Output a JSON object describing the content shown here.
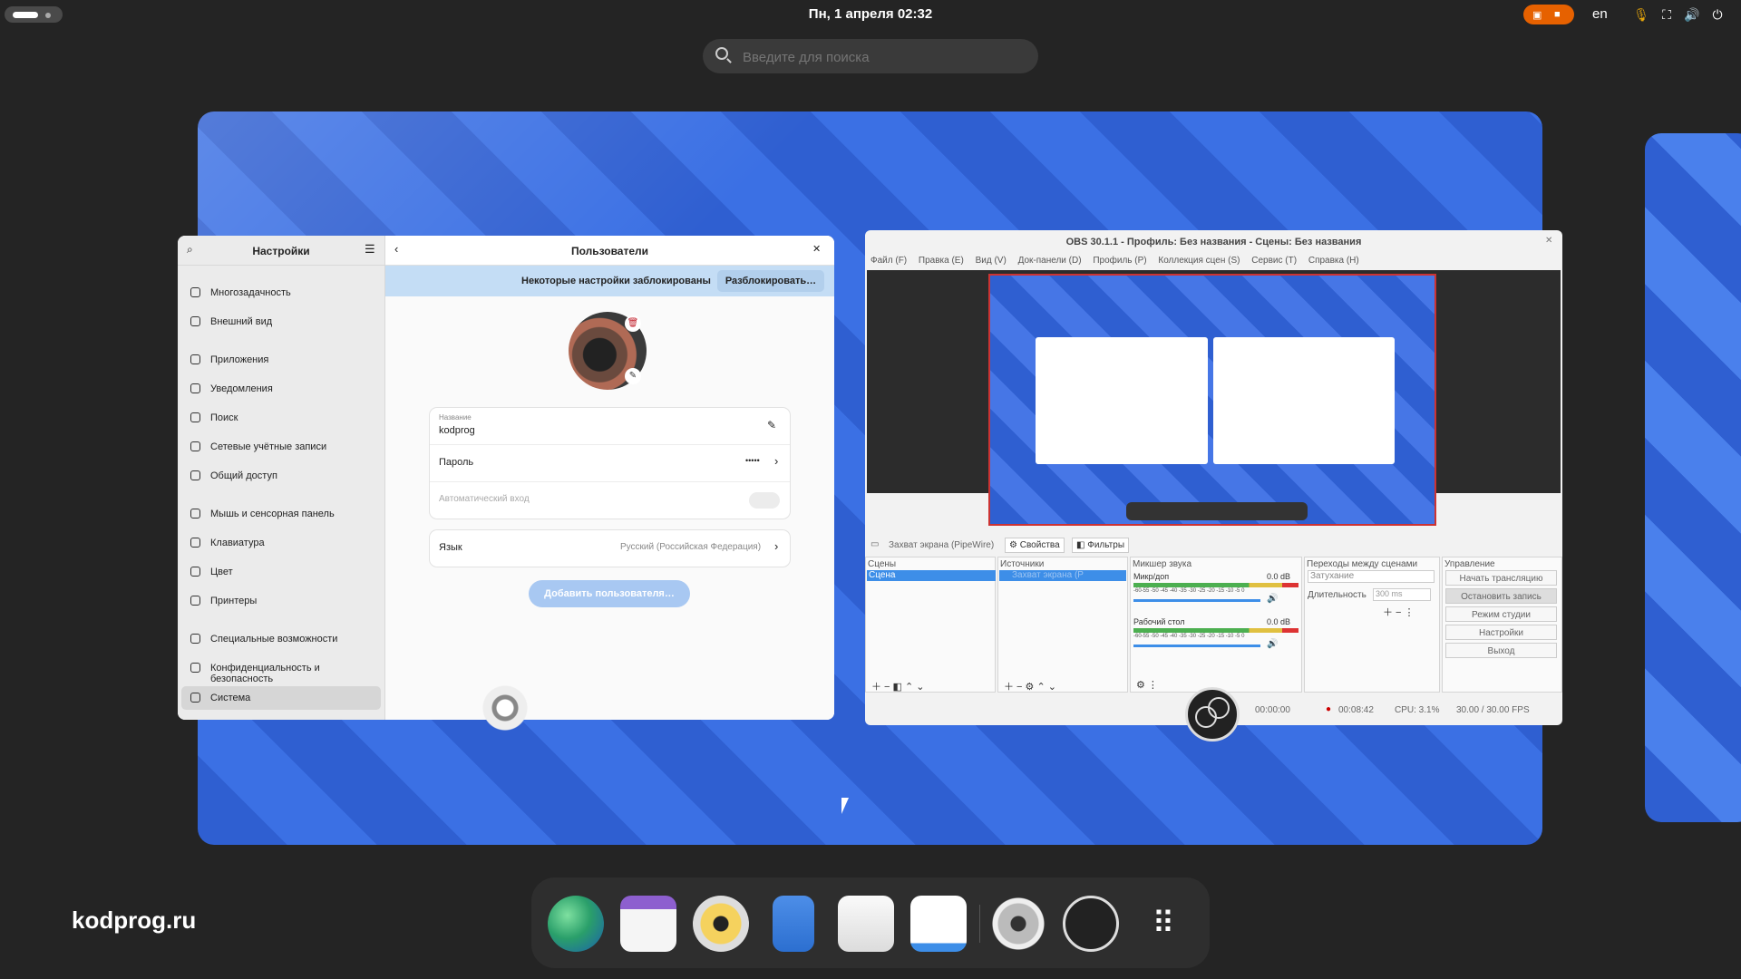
{
  "topbar": {
    "clock": "Пн, 1 апреля  02:32",
    "lang": "en"
  },
  "search": {
    "placeholder": "Введите для поиска"
  },
  "settings": {
    "sidebar_title": "Настройки",
    "page_title": "Пользователи",
    "sidebar_items": [
      "Многозадачность",
      "Внешний вид",
      "Приложения",
      "Уведомления",
      "Поиск",
      "Сетевые учётные записи",
      "Общий доступ",
      "Мышь и сенсорная панель",
      "Клавиатура",
      "Цвет",
      "Принтеры",
      "Специальные возможности",
      "Конфиденциальность и безопасность",
      "Система"
    ],
    "banner_text": "Некоторые настройки заблокированы",
    "unlock_button": "Разблокировать…",
    "name_label": "Название",
    "name_value": "kodprog",
    "password_label": "Пароль",
    "password_value": "•••••",
    "autologin_label": "Автоматический вход",
    "language_label": "Язык",
    "language_value": "Русский (Российская Федерация)",
    "add_user_button": "Добавить пользователя…"
  },
  "obs": {
    "title": "OBS 30.1.1 - Профиль: Без названия - Сцены: Без названия",
    "menu": [
      "Файл (F)",
      "Правка (E)",
      "Вид (V)",
      "Док-панели (D)",
      "Профиль (P)",
      "Коллекция сцен (S)",
      "Сервис (T)",
      "Справка (H)"
    ],
    "source_tab": "Захват экрана (PipeWire)",
    "properties_tab": "Свойства",
    "filters_tab": "Фильтры",
    "docks": {
      "scenes": "Сцены",
      "scene_item": "Сцена",
      "sources": "Источники",
      "source_item": "Захват экрана (P",
      "mixer": "Микшер звука",
      "mic": "Микр/доп",
      "mic_db": "0.0 dB",
      "desktop": "Рабочий стол",
      "desktop_db": "0.0 dB",
      "meter_scale": "-60-55 -50 -45 -40 -35 -30 -25 -20 -15 -10 -5 0",
      "transitions": "Переходы между сценами",
      "transition_value": "Затухание",
      "duration_label": "Длительность",
      "duration_value": "300 ms",
      "controls": "Управление",
      "ctrl_buttons": [
        "Начать трансляцию",
        "Остановить запись",
        "Режим студии",
        "Настройки",
        "Выход"
      ]
    },
    "status": {
      "stream_time": "00:00:00",
      "rec_time": "00:08:42",
      "cpu": "CPU: 3.1%",
      "fps": "30.00 / 30.00 FPS"
    }
  },
  "brand": "kodprog.ru",
  "dock_apps": [
    "browser-icon",
    "calendar-icon",
    "music-icon",
    "files-icon",
    "software-icon",
    "text-editor-icon",
    "settings-icon",
    "obs-icon",
    "app-grid-icon"
  ]
}
